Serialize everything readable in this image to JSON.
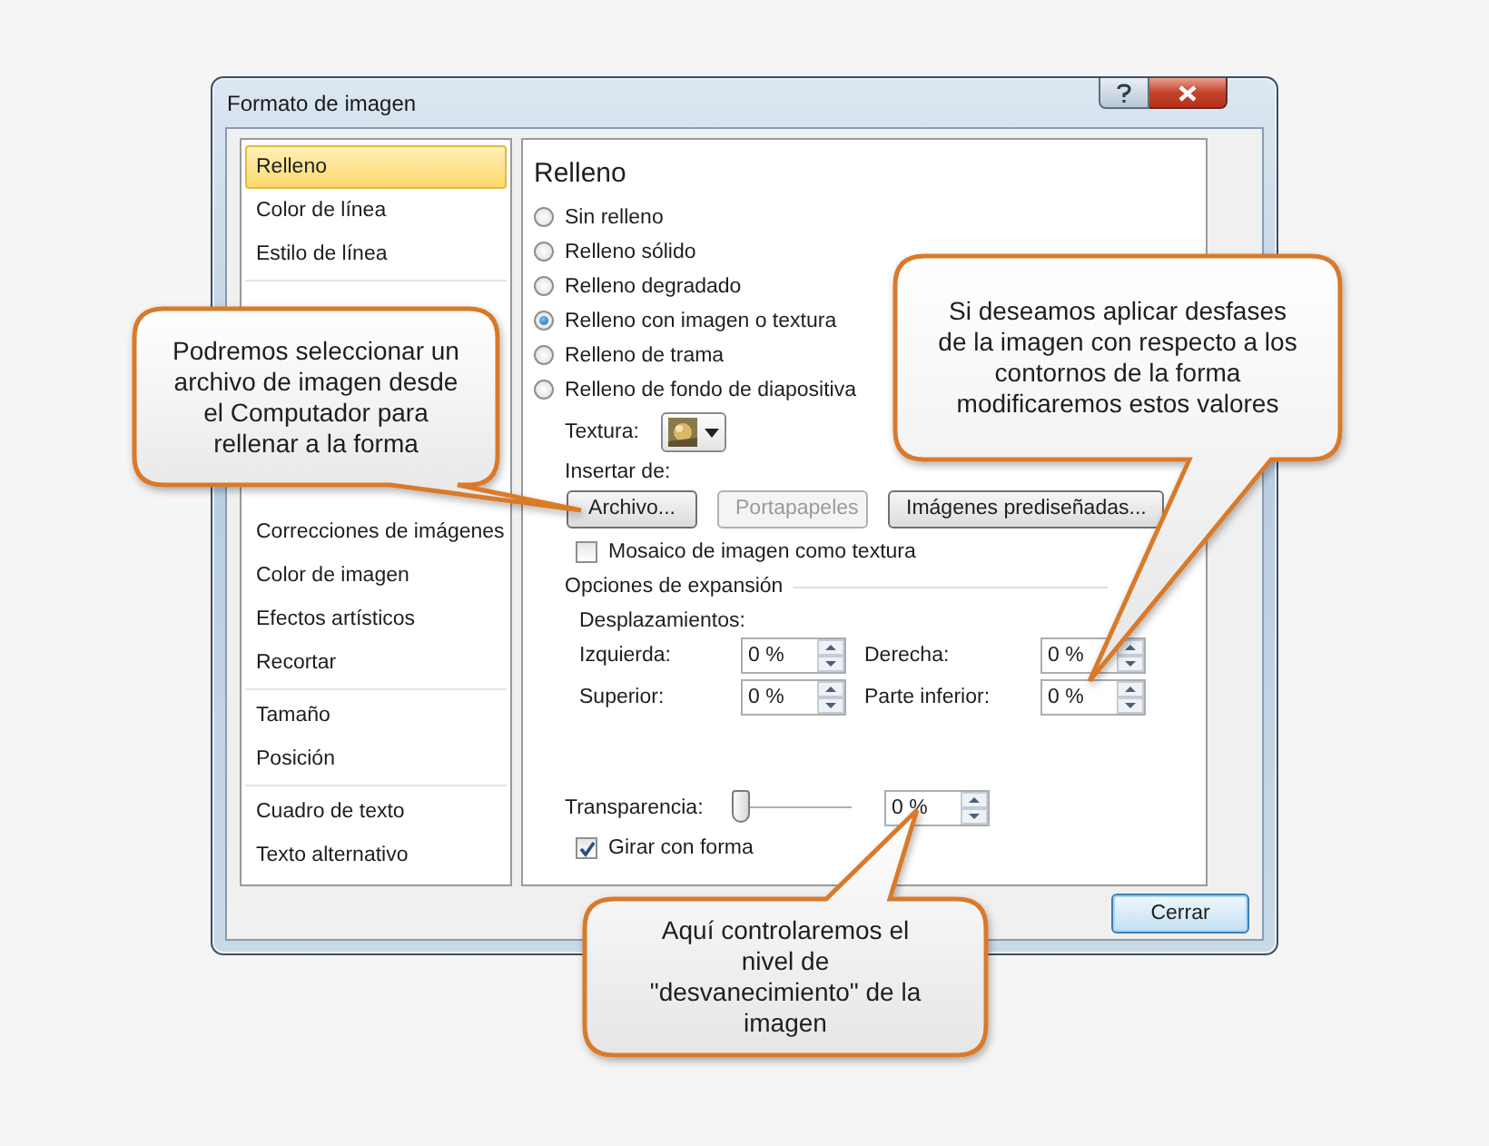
{
  "window": {
    "title": "Formato de imagen"
  },
  "sidebar": {
    "groups": [
      {
        "items": [
          {
            "label": "Relleno",
            "selected": true
          },
          {
            "label": "Color de línea",
            "selected": false
          },
          {
            "label": "Estilo de línea",
            "selected": false
          }
        ]
      },
      {
        "items": [
          {
            "label": "Correcciones de imágenes",
            "selected": false
          },
          {
            "label": "Color de imagen",
            "selected": false
          },
          {
            "label": "Efectos artísticos",
            "selected": false
          },
          {
            "label": "Recortar",
            "selected": false
          }
        ]
      },
      {
        "items": [
          {
            "label": "Tamaño",
            "selected": false
          },
          {
            "label": "Posición",
            "selected": false
          }
        ]
      },
      {
        "items": [
          {
            "label": "Cuadro de texto",
            "selected": false
          },
          {
            "label": "Texto alternativo",
            "selected": false
          }
        ]
      }
    ]
  },
  "panel": {
    "heading": "Relleno",
    "fill_options": [
      {
        "label": "Sin relleno",
        "selected": false
      },
      {
        "label": "Relleno sólido",
        "selected": false
      },
      {
        "label": "Relleno degradado",
        "selected": false
      },
      {
        "label": "Relleno con imagen o textura",
        "selected": true
      },
      {
        "label": "Relleno de trama",
        "selected": false
      },
      {
        "label": "Relleno de fondo de diapositiva",
        "selected": false
      }
    ],
    "texture_label": "Textura:",
    "insert_label": "Insertar de:",
    "insert_buttons": [
      {
        "label": "Archivo...",
        "disabled": false
      },
      {
        "label": "Portapapeles",
        "disabled": true
      },
      {
        "label": "Imágenes prediseñadas...",
        "disabled": false
      }
    ],
    "tile_checkbox": {
      "label": "Mosaico de imagen como textura",
      "checked": false
    },
    "expansion_heading": "Opciones de expansión",
    "offsets_label": "Desplazamientos:",
    "offsets": [
      {
        "label": "Izquierda:",
        "value": "0 %"
      },
      {
        "label": "Derecha:",
        "value": "0 %"
      },
      {
        "label": "Superior:",
        "value": "0 %"
      },
      {
        "label": "Parte inferior:",
        "value": "0 %"
      }
    ],
    "transparency": {
      "label": "Transparencia:",
      "level": 0,
      "value": "0 %"
    },
    "rotate_checkbox": {
      "label": "Girar con forma",
      "checked": true
    }
  },
  "close_button": "Cerrar",
  "callouts": [
    {
      "text": "Podremos seleccionar un archivo de imagen desde el Computador para rellenar a la forma"
    },
    {
      "text": "Si deseamos aplicar desfases de la imagen con respecto a los contornos de la forma modificaremos estos valores"
    },
    {
      "text": "Aquí controlaremos el nivel de \"desvanecimiento\" de la imagen"
    }
  ]
}
